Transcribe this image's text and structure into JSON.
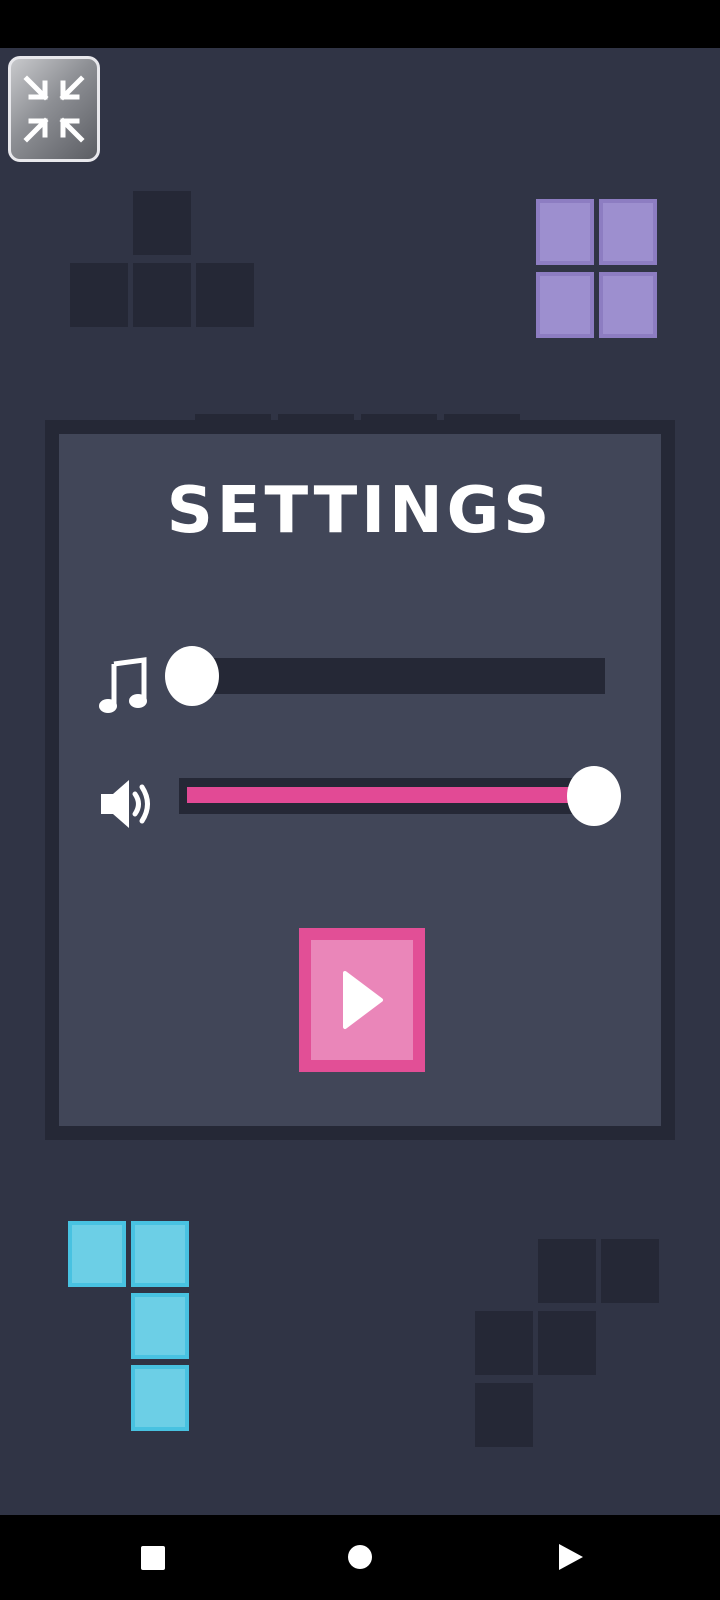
{
  "settings": {
    "title": "SETTINGS",
    "music_volume": 0.0,
    "sound_volume": 1.0
  },
  "icons": {
    "minimize": "minimize-arrows-icon",
    "music": "music-note-icon",
    "sound": "speaker-icon",
    "play": "play-icon",
    "nav_back": "back-triangle-icon",
    "nav_home": "home-circle-icon",
    "nav_recents": "recents-square-icon"
  },
  "colors": {
    "background": "#303445",
    "panel": "#414658",
    "panel_border": "#252836",
    "accent_pink": "#e24a95",
    "play_fill": "#ea86b9",
    "block_purple": "#9d8fcf",
    "block_cyan": "#6ccfe6",
    "block_dark": "#252836"
  }
}
